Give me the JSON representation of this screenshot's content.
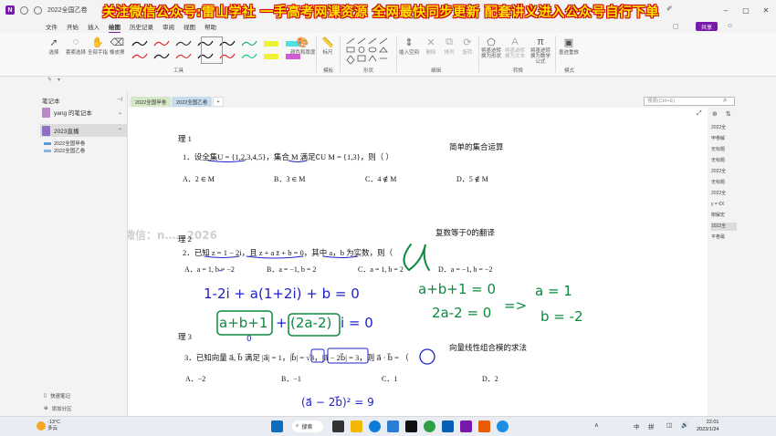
{
  "window": {
    "title": "2022全国乙卷",
    "banner": "关注微信公众号:雷山学社  一手高考网课资源  全网最快同步更新  配套讲义进入公众号自行下单",
    "controls": [
      "–",
      "▢",
      "✕"
    ]
  },
  "menu": {
    "items": [
      "文件",
      "开始",
      "插入",
      "绘图",
      "历史记录",
      "审阅",
      "视图",
      "帮助"
    ],
    "active_index": 3,
    "share": "共享"
  },
  "ribbon": {
    "tools": [
      "选择",
      "套索选择",
      "全部手指",
      "橡皮擦"
    ],
    "tools_group": "工具",
    "color_tool": "颜色和厚度",
    "ruler": "标尺",
    "ruler_group": "模板",
    "shapes_group": "形状",
    "edit_tools": [
      "插入空间",
      "删除",
      "排列",
      "旋转"
    ],
    "edit_group": "编辑",
    "convert_tools": [
      "将墨迹转换为形状",
      "将墨迹转换为文本",
      "将墨迹转换为数学公式"
    ],
    "convert_group": "转换",
    "mode_tool": "墨迹重放",
    "mode_group": "模式"
  },
  "quickbar": {
    "items": [
      "✎",
      "▾"
    ]
  },
  "nav": {
    "header": "笔记本",
    "pin": "⊣",
    "notebooks": [
      {
        "label": "yang 的笔记本",
        "color": "#b98ac5",
        "selected": false
      },
      {
        "label": "2023直播",
        "color": "#8e6fc1",
        "selected": true
      }
    ],
    "sections": [
      "2022全国甲卷",
      "2022全国乙卷"
    ],
    "footer": [
      "快速笔记",
      "添加分区"
    ]
  },
  "tabs": {
    "sections": [
      "2022全国甲卷",
      "2022全国乙卷"
    ],
    "add": "+",
    "search_placeholder": "搜索(Ctrl+E)"
  },
  "page": {
    "q1_head": "理 1",
    "q1_text": "1．设全集U = {1,2,3,4,5}，集合 M 满足∁U M = {1,3}，则（      ）",
    "q1_options": [
      "A．2 ∈ M",
      "B．3 ∈ M",
      "C．4 ∉ M",
      "D．5 ∉ M"
    ],
    "q1_note": "简单的集合运算",
    "watermark": "更多课程微信：n……2026",
    "q2_head": "理 2",
    "q2_text": "2．已知 z = 1 − 2i，且 z + a z̄ + b = 0，其中 a，b 为实数，则（",
    "q2_options": [
      "A．a = 1, b = −2",
      "B．a = −1, b = 2",
      "C．a = 1, b = 2",
      "D．a = −1, b = −2"
    ],
    "q2_note": "复数等于0的翻译",
    "hw_line1": "1-2i + a(1+2i) + b = 0",
    "hw_line2a": "a+b+1",
    "hw_line2b": "+",
    "hw_line2c": "(2a-2)",
    "hw_line2d": "i = 0",
    "hw_zero": "0",
    "hw_g1": "a+b+1 = 0",
    "hw_g2": "2a-2 = 0",
    "hw_arrow": "=>",
    "hw_g3": "a = 1",
    "hw_g4": "b = -2",
    "q3_head": "理 3",
    "q3_text": "3．已知向量 a⃗, b⃗ 满足 |a⃗| = 1，|b⃗| = √3，|a⃗ − 2b⃗| = 3，则 a⃗ · b⃗ = （",
    "q3_options": [
      "A．−2",
      "B．−1",
      "C．1",
      "D．2"
    ],
    "q3_note": "向量线性组合模的求法",
    "hw_bottom": "(a⃗ − 2b⃗)² = 9"
  },
  "pagelist": {
    "items": [
      "2022全",
      "甲卷解",
      "无标题",
      "无标题",
      "2022全",
      "无标题",
      "2022全",
      "y = €X",
      "柳解宏",
      "2022全",
      "平卷最"
    ],
    "selected_index": 9
  },
  "taskbar": {
    "temp": "-13°C",
    "weather": "多云",
    "search": "搜索",
    "tray": [
      "∧",
      "中",
      "拼",
      "◫",
      "🔊"
    ],
    "time": "22:01",
    "date": "2023/1/24"
  },
  "colors": {
    "accent": "#7719aa",
    "banner_text": "#ffe200",
    "banner_outline": "#cc0000",
    "ink_blue": "#2020c8",
    "ink_green": "#0b8a3e"
  }
}
